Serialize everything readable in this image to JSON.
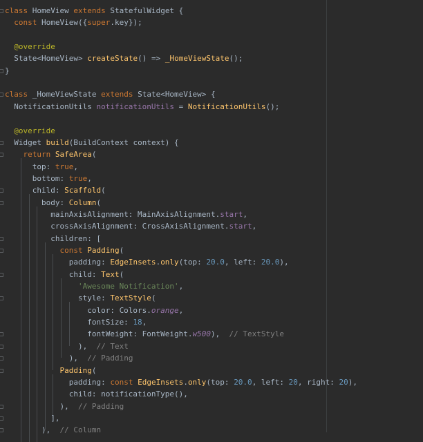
{
  "editor": {
    "lines": [
      {
        "t": [
          [
            "kw",
            "class "
          ],
          [
            "pl",
            "HomeView "
          ],
          [
            "kw",
            "extends "
          ],
          [
            "pl",
            "StatefulWidget {"
          ]
        ]
      },
      {
        "t": [
          [
            "pl",
            "  "
          ],
          [
            "kw",
            "const "
          ],
          [
            "pl",
            "HomeView({"
          ],
          [
            "kw",
            "super"
          ],
          [
            "pl",
            ".key});"
          ]
        ]
      },
      {
        "t": []
      },
      {
        "t": [
          [
            "pl",
            "  "
          ],
          [
            "an",
            "@override"
          ]
        ]
      },
      {
        "t": [
          [
            "pl",
            "  State<HomeView> "
          ],
          [
            "fn",
            "createState"
          ],
          [
            "pl",
            "() => "
          ],
          [
            "fn",
            "_HomeViewState"
          ],
          [
            "pl",
            "();"
          ]
        ]
      },
      {
        "t": [
          [
            "pl",
            "}"
          ]
        ]
      },
      {
        "t": []
      },
      {
        "t": [
          [
            "kw",
            "class "
          ],
          [
            "pl",
            "_HomeViewState "
          ],
          [
            "kw",
            "extends "
          ],
          [
            "pl",
            "State<HomeView> {"
          ]
        ]
      },
      {
        "t": [
          [
            "pl",
            "  NotificationUtils "
          ],
          [
            "prop",
            "notificationUtils"
          ],
          [
            "pl",
            " = "
          ],
          [
            "fn",
            "NotificationUtils"
          ],
          [
            "pl",
            "();"
          ]
        ]
      },
      {
        "t": []
      },
      {
        "t": [
          [
            "pl",
            "  "
          ],
          [
            "an",
            "@override"
          ]
        ]
      },
      {
        "t": [
          [
            "pl",
            "  Widget "
          ],
          [
            "fn",
            "build"
          ],
          [
            "pl",
            "(BuildContext context) {"
          ]
        ]
      },
      {
        "t": [
          [
            "pl",
            "    "
          ],
          [
            "kw",
            "return "
          ],
          [
            "fn",
            "SafeArea"
          ],
          [
            "pl",
            "("
          ]
        ]
      },
      {
        "t": [
          [
            "pl",
            "      top: "
          ],
          [
            "kw",
            "true"
          ],
          [
            "pl",
            ","
          ]
        ]
      },
      {
        "t": [
          [
            "pl",
            "      bottom: "
          ],
          [
            "kw",
            "true"
          ],
          [
            "pl",
            ","
          ]
        ]
      },
      {
        "t": [
          [
            "pl",
            "      child: "
          ],
          [
            "fn",
            "Scaffold"
          ],
          [
            "pl",
            "("
          ]
        ]
      },
      {
        "t": [
          [
            "pl",
            "        body: "
          ],
          [
            "fn",
            "Column"
          ],
          [
            "pl",
            "("
          ]
        ]
      },
      {
        "t": [
          [
            "pl",
            "          mainAxisAlignment: MainAxisAlignment."
          ],
          [
            "prop",
            "start"
          ],
          [
            "pl",
            ","
          ]
        ]
      },
      {
        "t": [
          [
            "pl",
            "          crossAxisAlignment: CrossAxisAlignment."
          ],
          [
            "prop",
            "start"
          ],
          [
            "pl",
            ","
          ]
        ]
      },
      {
        "t": [
          [
            "pl",
            "          children: ["
          ]
        ]
      },
      {
        "t": [
          [
            "pl",
            "            "
          ],
          [
            "kw",
            "const "
          ],
          [
            "fn",
            "Padding"
          ],
          [
            "pl",
            "("
          ]
        ]
      },
      {
        "t": [
          [
            "pl",
            "              padding: "
          ],
          [
            "fn",
            "EdgeInsets"
          ],
          [
            "pl",
            "."
          ],
          [
            "fn",
            "only"
          ],
          [
            "pl",
            "(top: "
          ],
          [
            "num",
            "20.0"
          ],
          [
            "pl",
            ", left: "
          ],
          [
            "num",
            "20.0"
          ],
          [
            "pl",
            "),"
          ]
        ]
      },
      {
        "t": [
          [
            "pl",
            "              child: "
          ],
          [
            "fn",
            "Text"
          ],
          [
            "pl",
            "("
          ]
        ]
      },
      {
        "t": [
          [
            "pl",
            "                "
          ],
          [
            "str",
            "'Awesome Notification'"
          ],
          [
            "pl",
            ","
          ]
        ]
      },
      {
        "t": [
          [
            "pl",
            "                style: "
          ],
          [
            "fn",
            "TextStyle"
          ],
          [
            "pl",
            "("
          ]
        ]
      },
      {
        "t": [
          [
            "pl",
            "                  color: Colors."
          ],
          [
            "it",
            "orange"
          ],
          [
            "pl",
            ","
          ]
        ]
      },
      {
        "t": [
          [
            "pl",
            "                  fontSize: "
          ],
          [
            "num",
            "18"
          ],
          [
            "pl",
            ","
          ]
        ]
      },
      {
        "t": [
          [
            "pl",
            "                  fontWeight: FontWeight."
          ],
          [
            "it",
            "w500"
          ],
          [
            "pl",
            "),  "
          ],
          [
            "cm",
            "// TextStyle"
          ]
        ]
      },
      {
        "t": [
          [
            "pl",
            "                ),  "
          ],
          [
            "cm",
            "// Text"
          ]
        ]
      },
      {
        "t": [
          [
            "pl",
            "              ),  "
          ],
          [
            "cm",
            "// Padding"
          ]
        ]
      },
      {
        "t": [
          [
            "pl",
            "            "
          ],
          [
            "fn",
            "Padding"
          ],
          [
            "pl",
            "("
          ]
        ]
      },
      {
        "t": [
          [
            "pl",
            "              padding: "
          ],
          [
            "kw",
            "const "
          ],
          [
            "fn",
            "EdgeInsets"
          ],
          [
            "pl",
            "."
          ],
          [
            "fn",
            "only"
          ],
          [
            "pl",
            "(top: "
          ],
          [
            "num",
            "20.0"
          ],
          [
            "pl",
            ", left: "
          ],
          [
            "num",
            "20"
          ],
          [
            "pl",
            ", right: "
          ],
          [
            "num",
            "20"
          ],
          [
            "pl",
            "),"
          ]
        ]
      },
      {
        "t": [
          [
            "pl",
            "              child: notificationType(),"
          ]
        ]
      },
      {
        "t": [
          [
            "pl",
            "            ),  "
          ],
          [
            "cm",
            "// Padding"
          ]
        ]
      },
      {
        "t": [
          [
            "pl",
            "          ],"
          ]
        ]
      },
      {
        "t": [
          [
            "pl",
            "        ),  "
          ],
          [
            "cm",
            "// Column"
          ]
        ]
      }
    ],
    "accent": "#cc7832",
    "background": "#2b2b2b"
  }
}
